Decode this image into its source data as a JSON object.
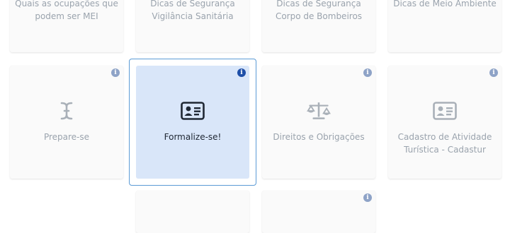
{
  "cards": {
    "mei": {
      "label_line1": "Quais as ocupações que",
      "label_line2": "podem ser MEI"
    },
    "seguranca_vigilancia": {
      "label_line1": "Dicas de Segurança",
      "label_line2": "Vigilância Sanitária"
    },
    "seguranca_bombeiros": {
      "label_line1": "Dicas de Segurança",
      "label_line2": "Corpo de Bombeiros"
    },
    "meio_ambiente": {
      "label_line1": "Dicas de Meio Ambiente"
    },
    "prepare": {
      "label": "Prepare-se",
      "icon": "cursor-text-icon"
    },
    "formalize": {
      "label": "Formalize-se!",
      "icon": "id-card-icon",
      "selected": true
    },
    "direitos": {
      "label": "Direitos e Obrigações",
      "icon": "scale-icon"
    },
    "cadastur": {
      "label_line1": "Cadastro de Atividade",
      "label_line2": "Turística - Cadastur",
      "icon": "id-card-icon"
    }
  },
  "colors": {
    "card_bg": "#fafafa",
    "selected_bg": "#d9e6f9",
    "selected_border": "#5b9bd5",
    "info_badge": "#8ea3c7",
    "info_badge_selected": "#1e4fa8",
    "muted_text": "#9aa3ad"
  }
}
